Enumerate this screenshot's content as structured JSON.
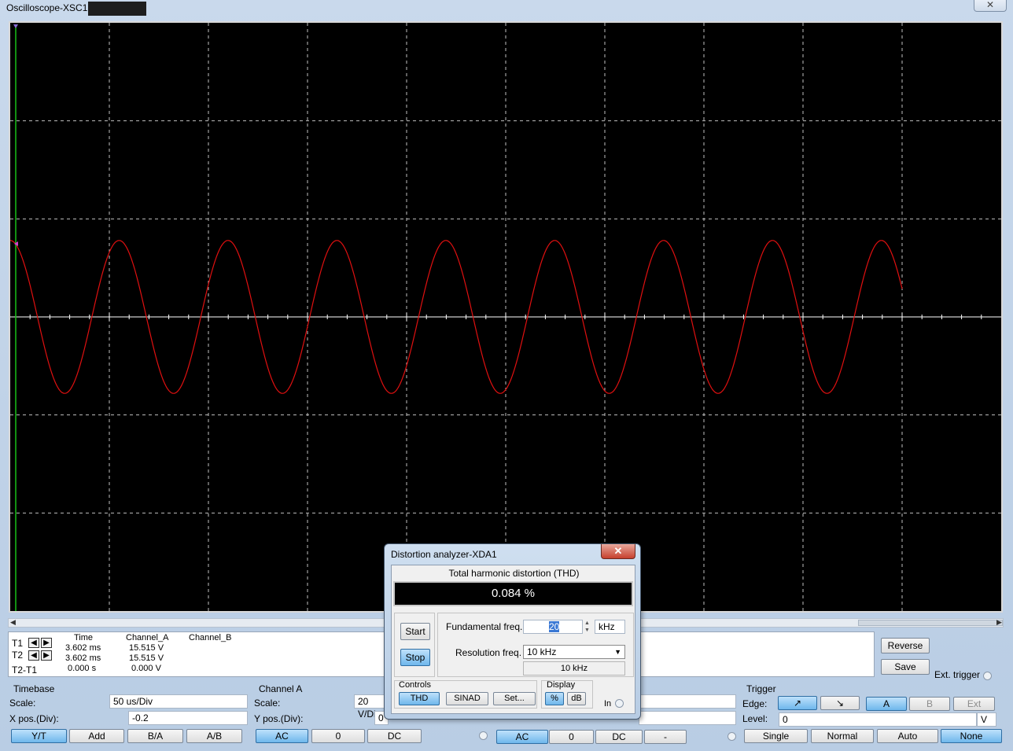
{
  "window": {
    "title": "Oscilloscope-XSC1",
    "close_glyph": "✕"
  },
  "colors": {
    "screen_bg": "#000000",
    "grid": "#bfbfbf",
    "trace_a": "#e01010",
    "cursor_t1": "#18c018",
    "pressed_button": "#6fb7ec"
  },
  "screen": {
    "waveform": {
      "channel": "A",
      "shape": "sine",
      "cycles_visible": 9.1,
      "peak_divisions": 0.78
    }
  },
  "cursor_panel": {
    "t1_label": "T1",
    "t2_label": "T2",
    "t2t1_label": "T2-T1",
    "left_arrow": "◀",
    "right_arrow": "▶",
    "headers": {
      "time": "Time",
      "channel_a": "Channel_A",
      "channel_b": "Channel_B"
    },
    "rows": [
      {
        "time": "3.602 ms",
        "channel_a": "15.515 V",
        "channel_b": ""
      },
      {
        "time": "3.602 ms",
        "channel_a": "15.515 V",
        "channel_b": ""
      },
      {
        "time": "0.000 s",
        "channel_a": "0.000 V",
        "channel_b": ""
      }
    ]
  },
  "side_buttons": {
    "reverse": "Reverse",
    "save": "Save",
    "ext_trigger": "Ext. trigger"
  },
  "timebase": {
    "title": "Timebase",
    "scale_label": "Scale:",
    "scale_value": "50 us/Div",
    "xpos_label": "X pos.(Div):",
    "xpos_value": "-0.2",
    "buttons": [
      "Y/T",
      "Add",
      "B/A",
      "A/B"
    ]
  },
  "channel_a": {
    "title": "Channel A",
    "scale_label": "Scale:",
    "scale_value": "20  V/Div",
    "ypos_label": "Y pos.(Div):",
    "ypos_value": "0",
    "buttons": [
      "AC",
      "0",
      "DC"
    ]
  },
  "channel_b": {
    "buttons": [
      "AC",
      "0",
      "DC",
      "-"
    ]
  },
  "trigger": {
    "title": "Trigger",
    "edge_label": "Edge:",
    "edge_rising": "↗",
    "edge_falling": "↘",
    "sources": [
      "A",
      "B",
      "Ext"
    ],
    "level_label": "Level:",
    "level_value": "0",
    "level_unit": "V",
    "modes": [
      "Single",
      "Normal",
      "Auto",
      "None"
    ]
  },
  "distortion_analyzer": {
    "title": "Distortion analyzer-XDA1",
    "close_glyph": "✕",
    "thd_title": "Total harmonic distortion (THD)",
    "thd_value": "0.084 %",
    "start_label": "Start",
    "stop_label": "Stop",
    "fundamental_label": "Fundamental freq.",
    "fundamental_value": "20",
    "fundamental_unit": "kHz",
    "resolution_label": "Resolution freq.",
    "resolution_value": "10 kHz",
    "resolution_readout": "10 kHz",
    "controls_title": "Controls",
    "controls_buttons": [
      "THD",
      "SINAD",
      "Set..."
    ],
    "display_title": "Display",
    "display_buttons": [
      "%",
      "dB"
    ],
    "in_label": "In"
  }
}
